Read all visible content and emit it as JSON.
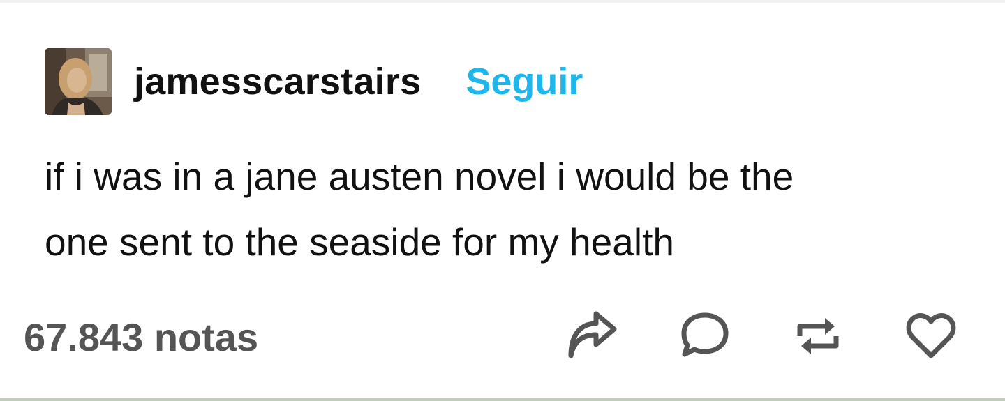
{
  "post": {
    "author": {
      "username": "jamesscarstairs",
      "follow_label": "Seguir"
    },
    "body_lines": [
      "if i was in a jane austen novel i would be the",
      "one sent to the seaside for my health"
    ],
    "notes_label": "67.843 notas"
  },
  "actions": {
    "share_icon": "share-icon",
    "reply_icon": "comment-icon",
    "reblog_icon": "reblog-icon",
    "like_icon": "heart-icon"
  },
  "colors": {
    "accent": "#1fb6ec",
    "text": "#111111",
    "muted": "#555555",
    "icon": "#555555"
  }
}
